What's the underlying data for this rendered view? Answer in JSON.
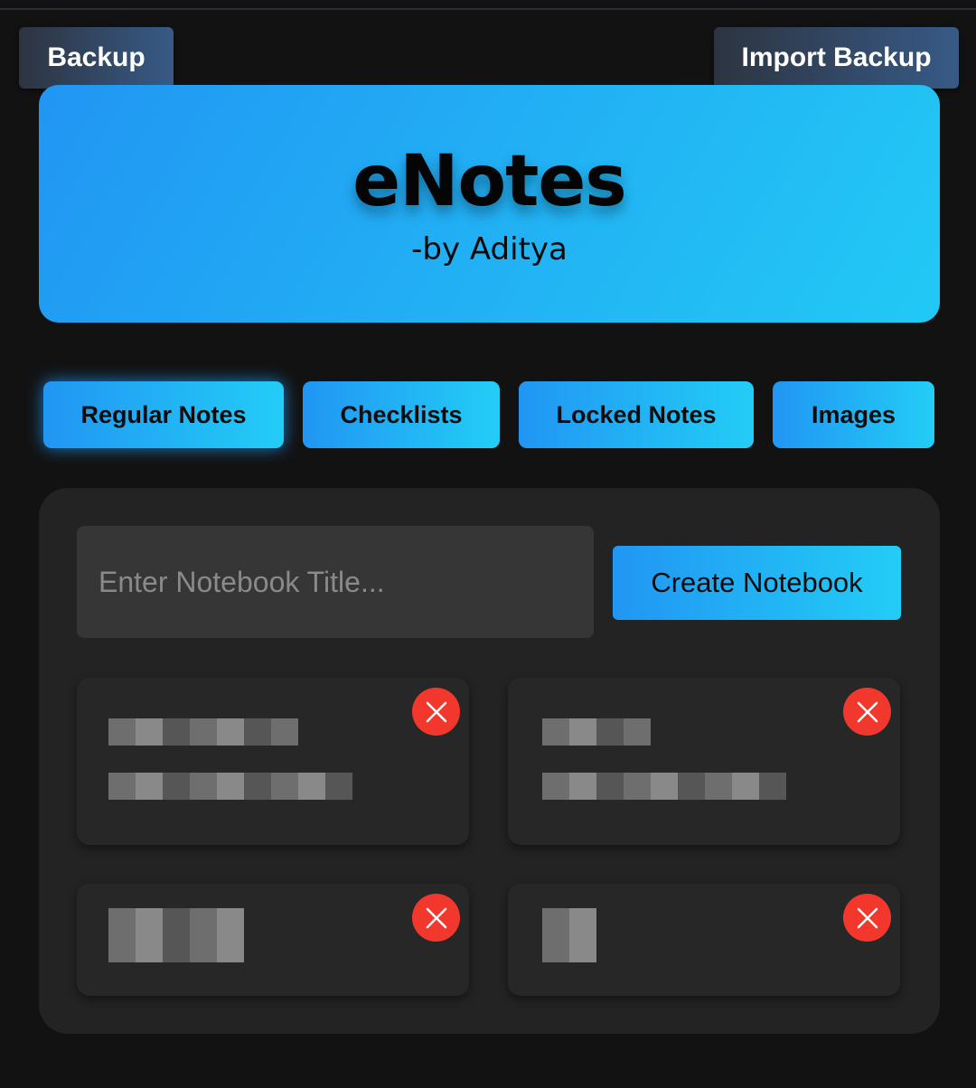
{
  "toolbar": {
    "backup_label": "Backup",
    "import_label": "Import Backup"
  },
  "header": {
    "title": "eNotes",
    "subtitle": "-by Aditya"
  },
  "tabs": [
    {
      "label": "Regular Notes",
      "active": true
    },
    {
      "label": "Checklists",
      "active": false
    },
    {
      "label": "Locked Notes",
      "active": false
    },
    {
      "label": "Images",
      "active": false
    }
  ],
  "notebook_form": {
    "input_placeholder": "Enter Notebook Title...",
    "input_value": "",
    "create_label": "Create Notebook"
  },
  "notebooks": [
    {
      "title": "",
      "description": "",
      "redacted": true
    },
    {
      "title": "",
      "description": "",
      "redacted": true
    },
    {
      "title": "",
      "description": "",
      "redacted": true
    },
    {
      "title": "",
      "description": "",
      "redacted": true
    }
  ],
  "icons": {
    "delete": "close-icon"
  },
  "colors": {
    "background": "#121212",
    "accent_start": "#2196f3",
    "accent_end": "#22c9f5",
    "panel": "#232323",
    "card": "#272727",
    "delete": "#f2382d"
  }
}
